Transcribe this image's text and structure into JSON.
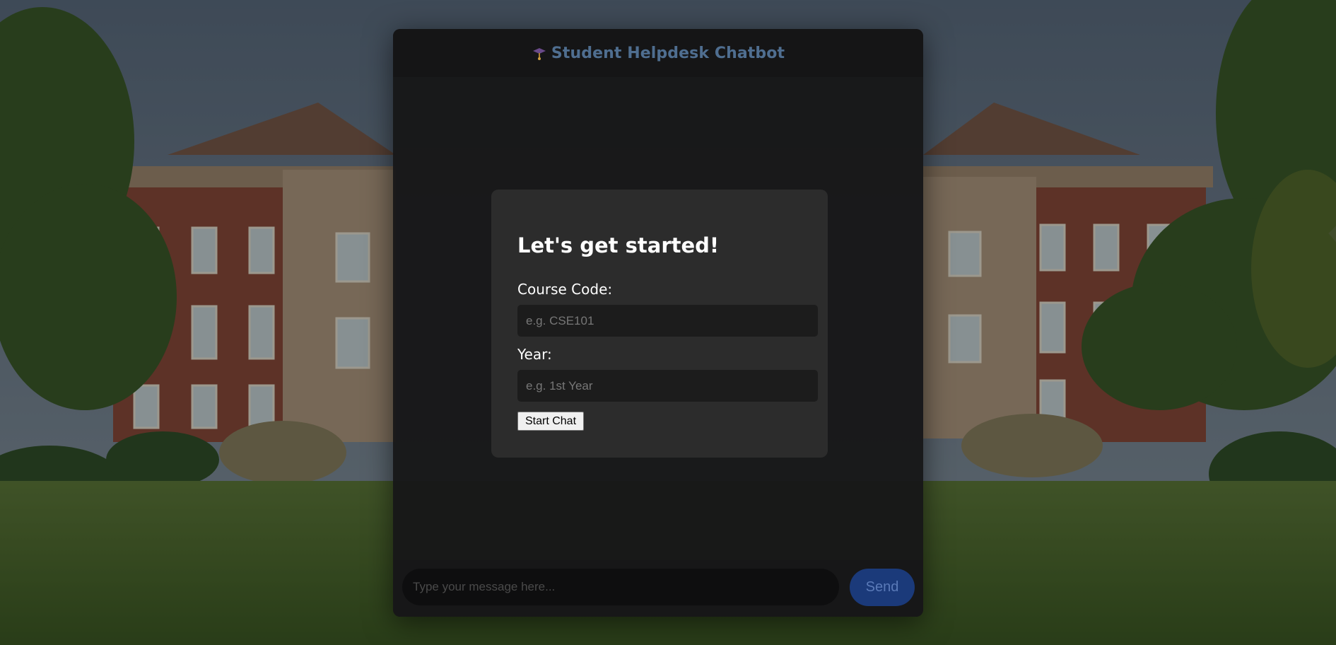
{
  "app": {
    "title": "Student Helpdesk Chatbot",
    "logo_icon": "graduation-icon",
    "title_color": "#4f6e90"
  },
  "modal": {
    "heading": "Let's get started!",
    "course_code": {
      "label": "Course Code:",
      "placeholder": "e.g. CSE101",
      "value": ""
    },
    "year": {
      "label": "Year:",
      "placeholder": "e.g. 1st Year",
      "value": ""
    },
    "start_button_label": "Start Chat"
  },
  "composer": {
    "placeholder": "Type your message here...",
    "value": "",
    "send_label": "Send",
    "send_color": "#1b3a7a"
  },
  "background": {
    "description_icon": "campus-building-image"
  }
}
